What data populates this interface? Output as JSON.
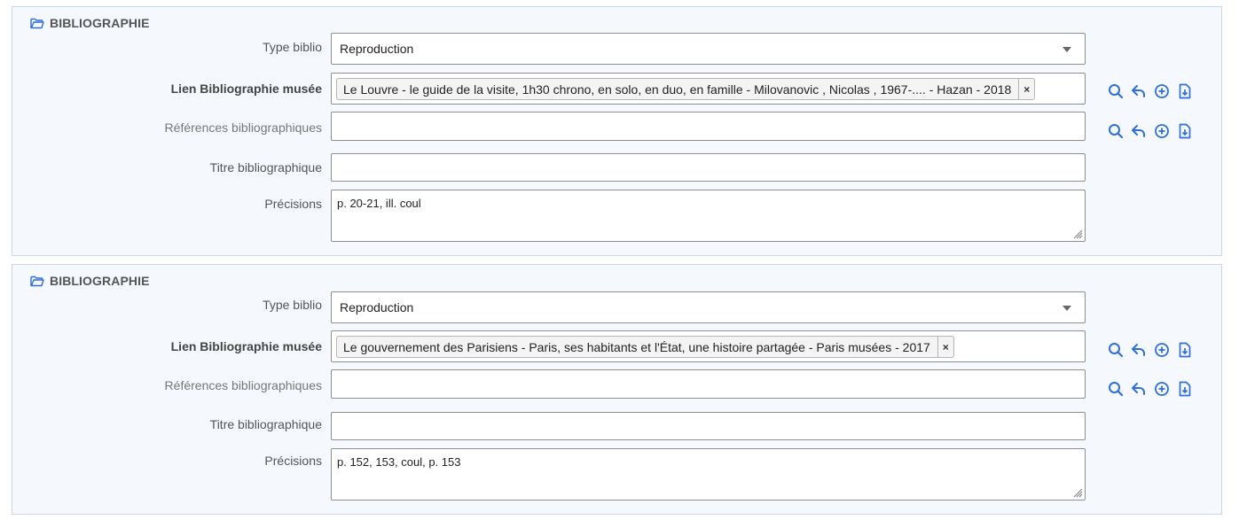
{
  "colors": {
    "accent": "#2f6fd6",
    "panel_bg": "#f5f8fd",
    "panel_border": "#c9d6e8"
  },
  "icons": {
    "header": "folder-open-icon",
    "actions": [
      "search-icon",
      "reply-icon",
      "add-circle-icon",
      "file-import-icon"
    ]
  },
  "sections": [
    {
      "title": "BIBLIOGRAPHIE",
      "type_label": "Type biblio",
      "type_value": "Reproduction",
      "lien_label": "Lien Bibliographie musée",
      "lien_tag": "Le Louvre - le guide de la visite, 1h30 chrono, en solo, en duo, en famille - Milovanovic , Nicolas , 1967-.... - Hazan - 2018",
      "tag_remove": "×",
      "refs_label": "Références bibliographiques",
      "refs_value": "",
      "titre_label": "Titre bibliographique",
      "titre_value": "",
      "precisions_label": "Précisions",
      "precisions_value": "p. 20-21, ill. coul"
    },
    {
      "title": "BIBLIOGRAPHIE",
      "type_label": "Type biblio",
      "type_value": "Reproduction",
      "lien_label": "Lien Bibliographie musée",
      "lien_tag": "Le gouvernement des Parisiens - Paris, ses habitants et l'État, une histoire partagée - Paris musées - 2017",
      "tag_remove": "×",
      "refs_label": "Références bibliographiques",
      "refs_value": "",
      "titre_label": "Titre bibliographique",
      "titre_value": "",
      "precisions_label": "Précisions",
      "precisions_value": "p. 152, 153, coul, p. 153"
    }
  ]
}
